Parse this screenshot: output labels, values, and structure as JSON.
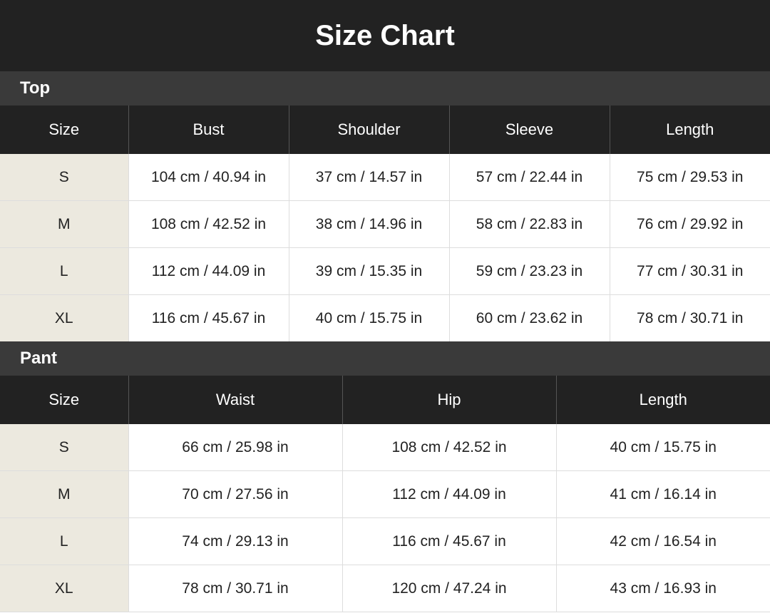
{
  "title": "Size Chart",
  "colors": {
    "header_bg": "#222222",
    "section_bg": "#3a3a3a",
    "size_col_bg": "#ece9df"
  },
  "top": {
    "label": "Top",
    "headers": [
      "Size",
      "Bust",
      "Shoulder",
      "Sleeve",
      "Length"
    ],
    "rows": [
      [
        "S",
        "104 cm / 40.94 in",
        "37 cm / 14.57 in",
        "57 cm / 22.44 in",
        "75 cm / 29.53 in"
      ],
      [
        "M",
        "108 cm / 42.52 in",
        "38 cm / 14.96 in",
        "58 cm / 22.83 in",
        "76 cm / 29.92 in"
      ],
      [
        "L",
        "112 cm / 44.09 in",
        "39 cm / 15.35 in",
        "59 cm / 23.23 in",
        "77 cm / 30.31 in"
      ],
      [
        "XL",
        "116 cm / 45.67 in",
        "40 cm / 15.75 in",
        "60 cm / 23.62 in",
        "78 cm / 30.71 in"
      ]
    ]
  },
  "pant": {
    "label": "Pant",
    "headers": [
      "Size",
      "Waist",
      "Hip",
      "Length"
    ],
    "rows": [
      [
        "S",
        "66 cm / 25.98 in",
        "108 cm / 42.52 in",
        "40 cm / 15.75 in"
      ],
      [
        "M",
        "70 cm / 27.56 in",
        "112 cm / 44.09 in",
        "41 cm / 16.14 in"
      ],
      [
        "L",
        "74 cm / 29.13 in",
        "116 cm / 45.67 in",
        "42 cm / 16.54 in"
      ],
      [
        "XL",
        "78 cm / 30.71 in",
        "120 cm / 47.24 in",
        "43 cm / 16.93 in"
      ]
    ]
  }
}
